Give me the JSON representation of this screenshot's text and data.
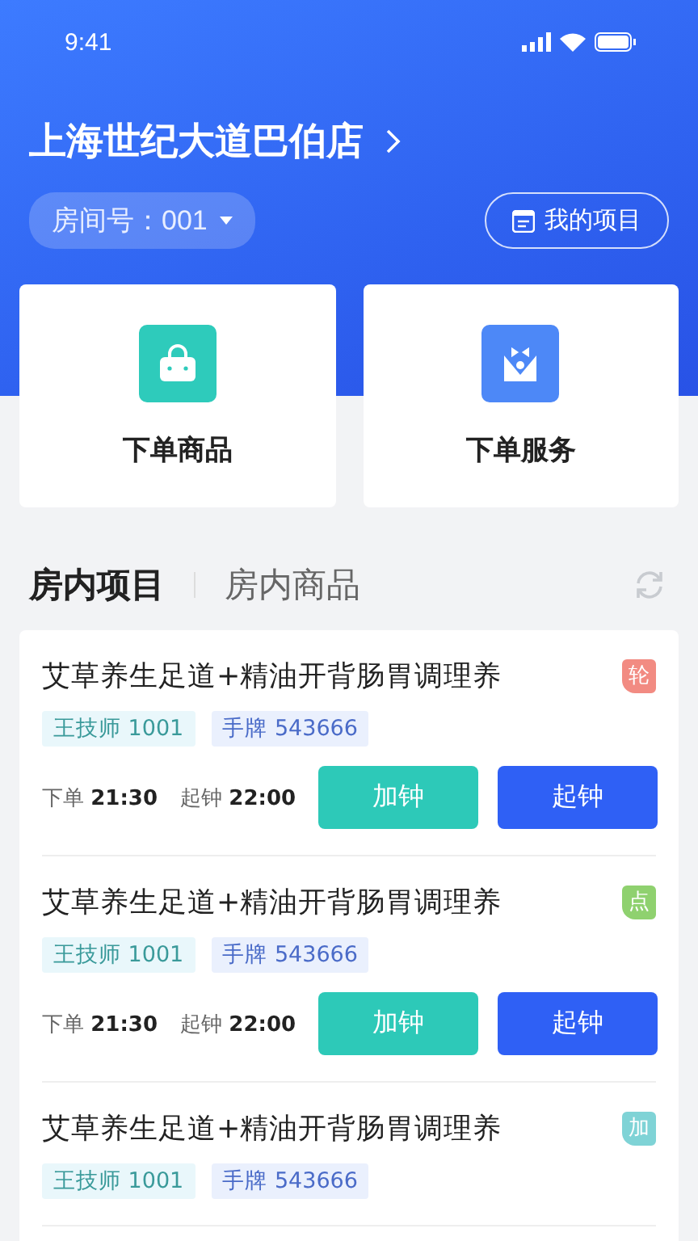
{
  "status_bar": {
    "time": "9:41"
  },
  "store": {
    "name": "上海世纪大道巴伯店",
    "room": "房间号：001",
    "my_items": "我的项目"
  },
  "shortcuts": [
    {
      "kind": "goods",
      "label": "下单商品"
    },
    {
      "kind": "service",
      "label": "下单服务"
    }
  ],
  "tabs": [
    {
      "label": "房内项目",
      "selected": true
    },
    {
      "label": "房内商品",
      "selected": false
    }
  ],
  "items": [
    {
      "title": "艾草养生足道+精油开背肠胃调理养",
      "badge": "轮",
      "color": "#f28b82",
      "tags": [
        "王技师 1001",
        "手牌 543666"
      ],
      "order_label": "下单",
      "order_time": "21:30",
      "start_label": "起钟",
      "start_time": "22:00",
      "actions": [
        "加钟",
        "起钟"
      ]
    },
    {
      "title": "艾草养生足道+精油开背肠胃调理养",
      "badge": "点",
      "color": "#8fd16f",
      "tags": [
        "王技师 1001",
        "手牌 543666"
      ],
      "order_label": "下单",
      "order_time": "21:30",
      "start_label": "起钟",
      "start_time": "22:00",
      "actions": [
        "加钟",
        "起钟"
      ]
    },
    {
      "title": "艾草养生足道+精油开背肠胃调理养",
      "badge": "加",
      "color": "#7fd3d6",
      "tags": [
        "王技师 1001",
        "手牌 543666"
      ]
    }
  ]
}
